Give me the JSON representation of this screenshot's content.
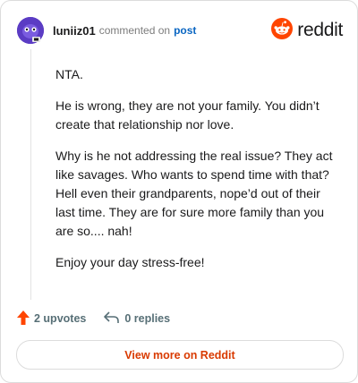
{
  "header": {
    "username": "luniiz01",
    "action_text": "commented on",
    "post_link": "post",
    "brand": "reddit"
  },
  "comment": {
    "paragraphs": [
      "NTA.",
      "He is wrong, they are not your family. You didn’t create that relationship nor love.",
      "Why is he not addressing the real issue? They act like savages. Who wants to spend time with that? Hell even their grandparents, nope’d out of their last time. They are for sure more family than you are so.... nah!",
      "Enjoy your day stress-free!"
    ]
  },
  "actions": {
    "upvotes": "2 upvotes",
    "replies": "0 replies"
  },
  "footer": {
    "view_more": "View more on Reddit"
  },
  "colors": {
    "accent": "#d93a00",
    "upvote": "#ff4500",
    "link": "#0a66c2",
    "avatar": "#5b3cc4"
  },
  "icons": {
    "avatar": "avatar-icon",
    "brand": "reddit-snoo-icon",
    "upvote": "upvote-arrow-icon",
    "reply": "reply-arrow-icon"
  }
}
